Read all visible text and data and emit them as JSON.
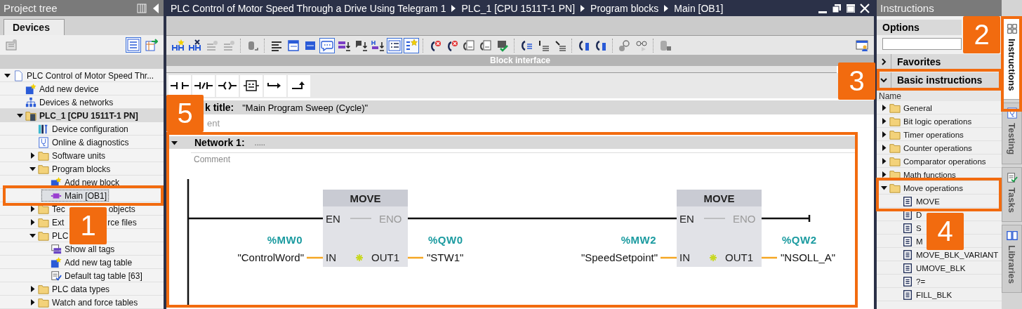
{
  "project_tree": {
    "title": "Project tree",
    "tabs": [
      {
        "label": "Devices",
        "selected": true
      }
    ],
    "toolbar": [
      {
        "pressed": false
      },
      {
        "pressed": true
      },
      {
        "pressed": false
      }
    ],
    "items": [
      {
        "label": "PLC Control of Motor Speed Thr...",
        "kind": "project",
        "expanded": true,
        "selected": false,
        "children": [
          {
            "label": "Add new device",
            "kind": "add",
            "selected": false
          },
          {
            "label": "Devices & networks",
            "kind": "network",
            "selected": false
          },
          {
            "label": "PLC_1 [CPU 1511T-1 PN]",
            "kind": "device",
            "expanded": true,
            "selected": false,
            "children": [
              {
                "label": "Device configuration",
                "kind": "config",
                "selected": false
              },
              {
                "label": "Online & diagnostics",
                "kind": "diagnostics",
                "selected": false
              },
              {
                "label": "Software units",
                "kind": "folder",
                "expanded": false,
                "selected": false
              },
              {
                "label": "Program blocks",
                "kind": "folder",
                "expanded": true,
                "selected": false,
                "children": [
                  {
                    "label": "Add new block",
                    "kind": "add",
                    "selected": false
                  },
                  {
                    "label": "Main [OB1]",
                    "kind": "block",
                    "selected": true
                  }
                ]
              },
              {
                "label": "Tec",
                "label_end": "objects",
                "kind": "folder",
                "expanded": false,
                "selected": false
              },
              {
                "label": "Ext",
                "label_end": "rce files",
                "kind": "folder",
                "expanded": false,
                "selected": false
              },
              {
                "label": "PLC",
                "kind": "folder",
                "expanded": true,
                "selected": false,
                "children": [
                  {
                    "label": "Show all tags",
                    "kind": "tags",
                    "selected": false
                  },
                  {
                    "label": "Add new tag table",
                    "kind": "add",
                    "selected": false
                  },
                  {
                    "label": "Default tag table [63]",
                    "kind": "table",
                    "selected": false
                  }
                ]
              },
              {
                "label": "PLC data types",
                "kind": "folder",
                "expanded": false,
                "selected": false
              },
              {
                "label": "Watch and force tables",
                "kind": "folder",
                "expanded": false,
                "selected": false
              }
            ]
          }
        ]
      }
    ]
  },
  "editor": {
    "breadcrumb": [
      "PLC Control of Motor Speed Through a Drive Using Telegram 1",
      "PLC_1 [CPU 1511T-1 PN]",
      "Program blocks",
      "Main [OB1]"
    ],
    "toolbar": [
      {
        "pressed": false
      },
      {
        "pressed": false
      },
      {
        "pressed": false
      },
      {
        "pressed": false
      },
      {
        "pressed": false
      },
      {
        "pressed": false
      },
      {
        "pressed": false
      },
      {
        "pressed": false
      },
      {
        "pressed": true
      },
      {
        "pressed": false
      },
      {
        "pressed": false
      },
      {
        "pressed": false
      },
      {
        "pressed": true
      },
      {
        "pressed": true
      },
      {
        "pressed": false
      },
      {
        "pressed": false
      },
      {
        "pressed": false
      },
      {
        "pressed": false
      },
      {
        "pressed": false
      },
      {
        "pressed": false
      },
      {
        "pressed": false
      },
      {
        "pressed": false
      },
      {
        "pressed": false
      },
      {
        "pressed": false
      },
      {
        "pressed": false
      },
      {
        "pressed": false
      },
      {
        "pressed": false
      }
    ],
    "interface_bar": "Block interface",
    "block_title": {
      "label": "k title:",
      "value": "\"Main Program Sweep (Cycle)\""
    },
    "block_comment_placeholder": "ent",
    "network": {
      "expanded": true,
      "title": "Network 1:",
      "dots": ".....",
      "comment_placeholder": "Comment",
      "blocks": [
        {
          "name": "MOVE",
          "en": "EN",
          "eno": "ENO",
          "in_pin": "IN",
          "out_pin": "OUT1",
          "input": {
            "address": "%MW0",
            "tag": "\"ControlWord\""
          },
          "output": {
            "address": "%QW0",
            "tag": "\"STW1\""
          }
        },
        {
          "name": "MOVE",
          "en": "EN",
          "eno": "ENO",
          "in_pin": "IN",
          "out_pin": "OUT1",
          "input": {
            "address": "%MW2",
            "tag": "\"SpeedSetpoint\""
          },
          "output": {
            "address": "%QW2",
            "tag": "\"NSOLL_A\""
          }
        }
      ]
    }
  },
  "instructions": {
    "title": "Instructions",
    "options": "Options",
    "sections": [
      {
        "label": "Favorites",
        "expanded": false
      },
      {
        "label": "Basic instructions",
        "expanded": true
      }
    ],
    "column": "Name",
    "items": [
      {
        "label": "General",
        "kind": "folder",
        "expanded": false,
        "selected": false
      },
      {
        "label": "Bit logic operations",
        "kind": "folder",
        "expanded": false,
        "selected": false
      },
      {
        "label": "Timer operations",
        "kind": "folder",
        "expanded": false,
        "selected": false
      },
      {
        "label": "Counter operations",
        "kind": "folder",
        "expanded": false,
        "selected": false
      },
      {
        "label": "Comparator operations",
        "kind": "folder",
        "expanded": false,
        "selected": false
      },
      {
        "label": "Math functions",
        "kind": "folder",
        "expanded": false,
        "selected": false
      },
      {
        "label": "Move operations",
        "kind": "folder",
        "expanded": true,
        "selected": false,
        "children": [
          {
            "label": "MOVE",
            "kind": "instruction",
            "selected": false
          },
          {
            "label": "D",
            "kind": "instruction",
            "selected": false
          },
          {
            "label": "S",
            "kind": "instruction",
            "selected": false
          },
          {
            "label": "M",
            "kind": "instruction",
            "selected": false
          },
          {
            "label": "MOVE_BLK_VARIANT",
            "kind": "instruction",
            "selected": false
          },
          {
            "label": "UMOVE_BLK",
            "kind": "instruction",
            "selected": false
          },
          {
            "label": "?=",
            "kind": "instruction",
            "selected": false
          },
          {
            "label": "FILL_BLK",
            "kind": "instruction",
            "selected": false
          }
        ]
      }
    ]
  },
  "side_tabs": [
    {
      "label": "Instructions",
      "selected": true
    },
    {
      "label": "Testing",
      "selected": false
    },
    {
      "label": "Tasks",
      "selected": false
    },
    {
      "label": "Libraries",
      "selected": false
    }
  ],
  "callouts": [
    {
      "label": "1"
    },
    {
      "label": "2"
    },
    {
      "label": "3"
    },
    {
      "label": "4"
    },
    {
      "label": "5"
    }
  ]
}
